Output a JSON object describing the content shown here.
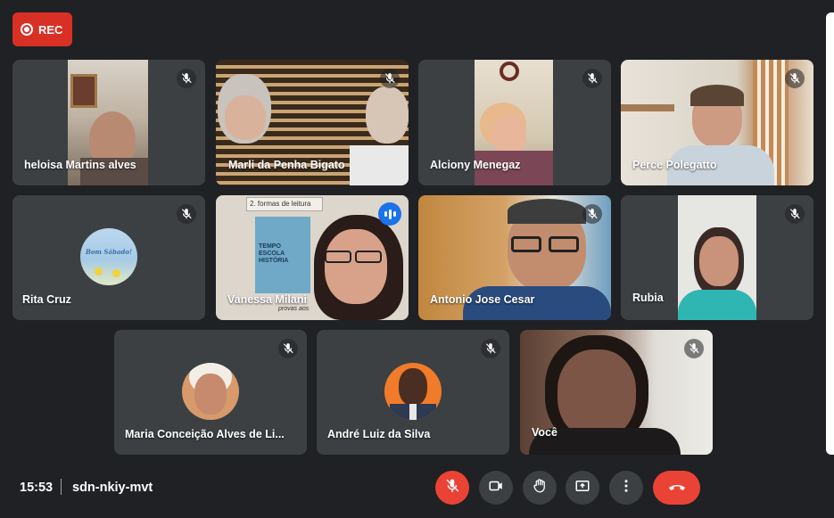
{
  "rec_label": "REC",
  "participants": [
    {
      "name": "heloisa Martins alves"
    },
    {
      "name": "Marli da Penha Bigato"
    },
    {
      "name": "Alciony Menegaz"
    },
    {
      "name": "Perce Polegatto"
    },
    {
      "name": "Rita Cruz"
    },
    {
      "name": "Vanessa Milani"
    },
    {
      "name": "Antonio Jose Cesar"
    },
    {
      "name": "Rubia"
    },
    {
      "name": "Maria Conceição Alves de Li..."
    },
    {
      "name": "André Luiz da Silva"
    },
    {
      "name": "Você"
    }
  ],
  "rita_avatar_text": "Bom Sábado!",
  "slide_heading": "2. formas de leitura",
  "book_title": "TEMPO ESCOLA HISTÓRIA",
  "slide_footer": "provas aos",
  "bottom_bar": {
    "time": "15:53",
    "meeting_code": "sdn-nkiy-mvt"
  },
  "icons": {
    "mic_off": "mic-off-icon",
    "camera": "video-camera-icon",
    "hand": "raise-hand-icon",
    "present": "present-screen-icon",
    "more": "more-options-icon",
    "leave": "leave-call-icon"
  },
  "colors": {
    "background": "#202124",
    "tile": "#3c4043",
    "rec": "#d93025",
    "danger": "#ea4335",
    "speaking": "#1a73e8",
    "active_outline": "#8ab4f8"
  }
}
